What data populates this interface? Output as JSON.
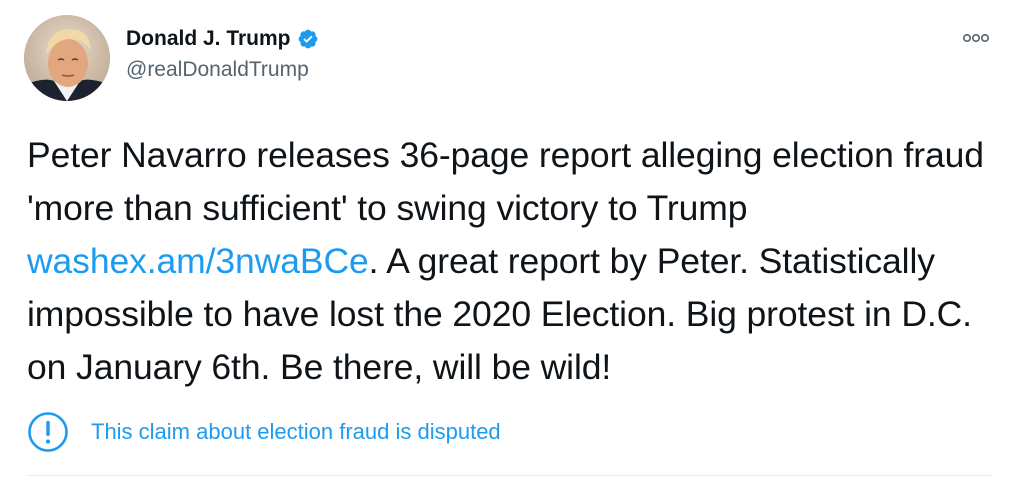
{
  "user": {
    "display_name": "Donald J. Trump",
    "handle": "@realDonaldTrump",
    "verified": true
  },
  "icons": {
    "verified": "verified-badge-icon",
    "more": "more-options-icon",
    "notice": "exclamation-circle-icon"
  },
  "tweet": {
    "text_part1": "Peter Navarro releases 36-page report alleging election fraud 'more than sufficient' to swing victory to Trump ",
    "link": "washex.am/3nwaBCe",
    "text_part2": ". A great report by Peter. Statistically impossible to have lost the 2020 Election. Big protest in D.C. on January 6th. Be there, will be wild!"
  },
  "notice": {
    "label": "This claim about election fraud is disputed"
  },
  "colors": {
    "link": "#1d9bf0",
    "text": "#0f1419",
    "secondary": "#536471",
    "divider": "#e6ecf0"
  }
}
